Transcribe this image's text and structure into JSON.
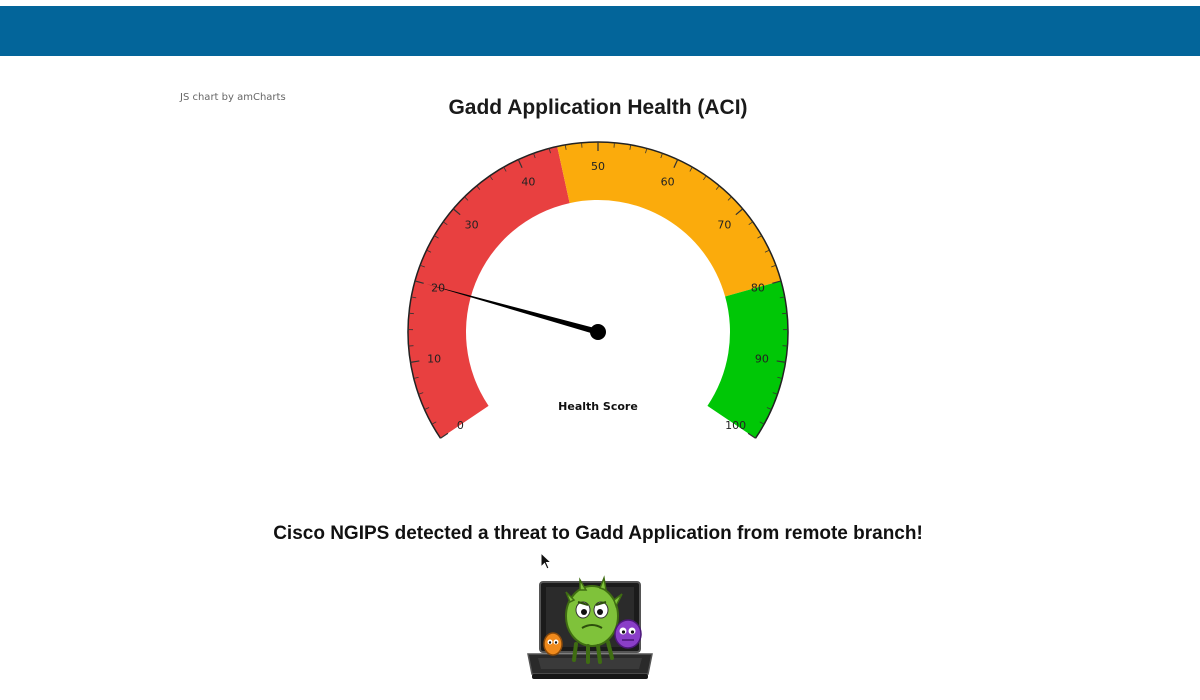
{
  "header": {
    "bar_color": "#03659a"
  },
  "credit_text": "JS chart by amCharts",
  "gauge": {
    "title": "Gadd Application Health (ACI)",
    "axis_label": "Health Score",
    "min": 0,
    "max": 100,
    "ticks": [
      "0",
      "10",
      "20",
      "30",
      "40",
      "50",
      "60",
      "70",
      "80",
      "90",
      "100"
    ],
    "value": 20,
    "bands": [
      {
        "from": 0,
        "to": 45,
        "color": "#e84040"
      },
      {
        "from": 45,
        "to": 80,
        "color": "#fbab0c"
      },
      {
        "from": 80,
        "to": 100,
        "color": "#00c706"
      }
    ]
  },
  "alert_text": "Cisco NGIPS detected a threat to Gadd Application from remote branch!",
  "illustration_icon": "virus-monsters-on-laptop-icon"
}
